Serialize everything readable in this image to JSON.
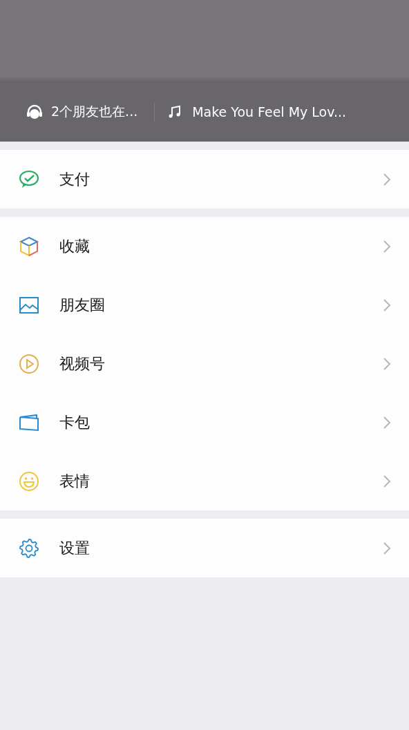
{
  "header": {
    "friends_listening": "2个朋友也在...",
    "song": "Make You Feel My Lov..."
  },
  "groups": [
    {
      "items": [
        {
          "kind": "pay",
          "label": "支付"
        }
      ]
    },
    {
      "items": [
        {
          "kind": "favorites",
          "label": "收藏"
        },
        {
          "kind": "moments",
          "label": "朋友圈"
        },
        {
          "kind": "channels",
          "label": "视频号"
        },
        {
          "kind": "cards",
          "label": "卡包"
        },
        {
          "kind": "stickers",
          "label": "表情"
        }
      ]
    },
    {
      "items": [
        {
          "kind": "settings",
          "label": "设置"
        }
      ]
    }
  ]
}
